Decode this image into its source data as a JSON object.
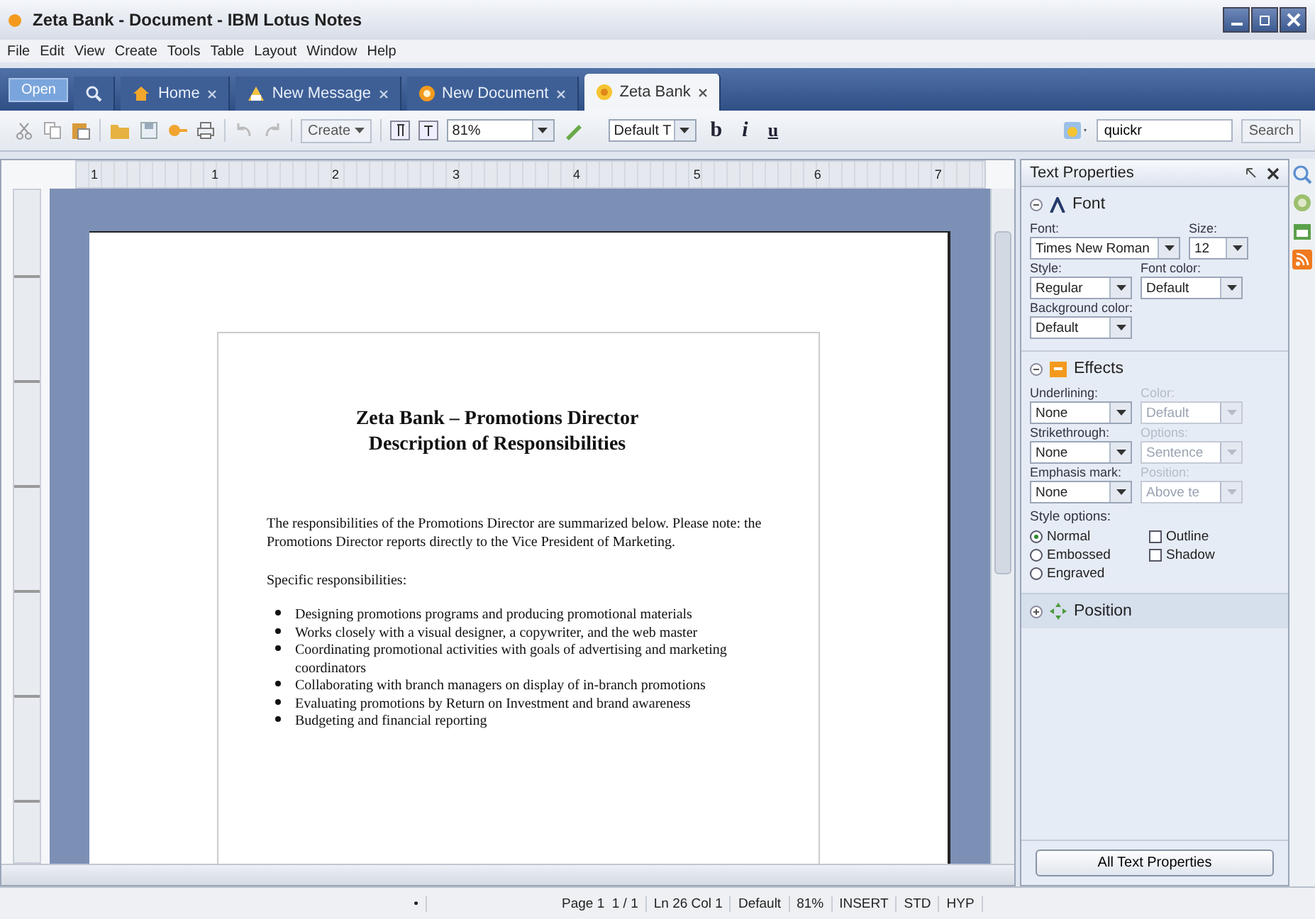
{
  "window": {
    "title": "Zeta Bank - Document - IBM Lotus Notes"
  },
  "menu": [
    "File",
    "Edit",
    "View",
    "Create",
    "Tools",
    "Table",
    "Layout",
    "Window",
    "Help"
  ],
  "open_button": "Open",
  "tabs": [
    {
      "label": "Home",
      "selected": false
    },
    {
      "label": "New Message",
      "selected": false
    },
    {
      "label": "New Document",
      "selected": false
    },
    {
      "label": "Zeta Bank",
      "selected": true
    }
  ],
  "toolbar": {
    "create": "Create",
    "zoom": "81%",
    "style": "Default T",
    "format_buttons": [
      "b",
      "i",
      "u"
    ],
    "search_value": "quickr",
    "search_button": "Search"
  },
  "ruler": [
    "1",
    "1",
    "2",
    "3",
    "4",
    "5",
    "6",
    "7"
  ],
  "document": {
    "title_lines": [
      "Zeta Bank – Promotions Director",
      "Description of Responsibilities"
    ],
    "intro": "The responsibilities of the Promotions Director are summarized below.  Please note: the Promotions Director reports directly to the Vice President of Marketing.",
    "list_heading": "Specific responsibilities:",
    "bullets": [
      "Designing promotions programs and producing promotional materials",
      "Works closely with a visual designer, a copywriter, and the web master",
      "Coordinating promotional activities with goals of advertising and marketing coordinators",
      "Collaborating with branch managers on display of in-branch promotions",
      "Evaluating promotions by Return on Investment and brand awareness",
      "Budgeting and financial reporting"
    ]
  },
  "panel": {
    "title": "Text Properties",
    "sections": [
      {
        "title": "Font",
        "expanded": true,
        "fields": [
          {
            "label": "Font:",
            "value": "Times New Roman",
            "disabled": false
          },
          {
            "label": "Size:",
            "value": "12",
            "disabled": false
          },
          {
            "label": "Style:",
            "value": "Regular",
            "disabled": false
          },
          {
            "label": "Font color:",
            "value": "Default",
            "disabled": false
          },
          {
            "label": "Background color:",
            "value": "Default",
            "disabled": false
          }
        ]
      },
      {
        "title": "Effects",
        "expanded": true,
        "fields": [
          {
            "label": "Underlining:",
            "value": "None",
            "disabled": false
          },
          {
            "label": "Color:",
            "value": "Default",
            "disabled": true
          },
          {
            "label": "Strikethrough:",
            "value": "None",
            "disabled": false
          },
          {
            "label": "Options:",
            "value": "Sentence",
            "disabled": true
          },
          {
            "label": "Emphasis mark:",
            "value": "None",
            "disabled": false
          },
          {
            "label": "Position:",
            "value": "Above te",
            "disabled": true
          }
        ],
        "options_label": "Style options:",
        "options": [
          {
            "kind": "radio",
            "label": "Normal",
            "selected": true
          },
          {
            "kind": "checkbox",
            "label": "Outline",
            "checked": false
          },
          {
            "kind": "radio",
            "label": "Embossed",
            "selected": false
          },
          {
            "kind": "checkbox",
            "label": "Shadow",
            "checked": false
          },
          {
            "kind": "radio",
            "label": "Engraved",
            "selected": false
          }
        ]
      },
      {
        "title": "Position",
        "expanded": false
      }
    ],
    "button": "All Text Properties"
  },
  "status_bar": [
    "•",
    "Page 1  1 / 1",
    "Ln 26 Col 1",
    "Default",
    "81%",
    "INSERT",
    "STD",
    "HYP"
  ]
}
